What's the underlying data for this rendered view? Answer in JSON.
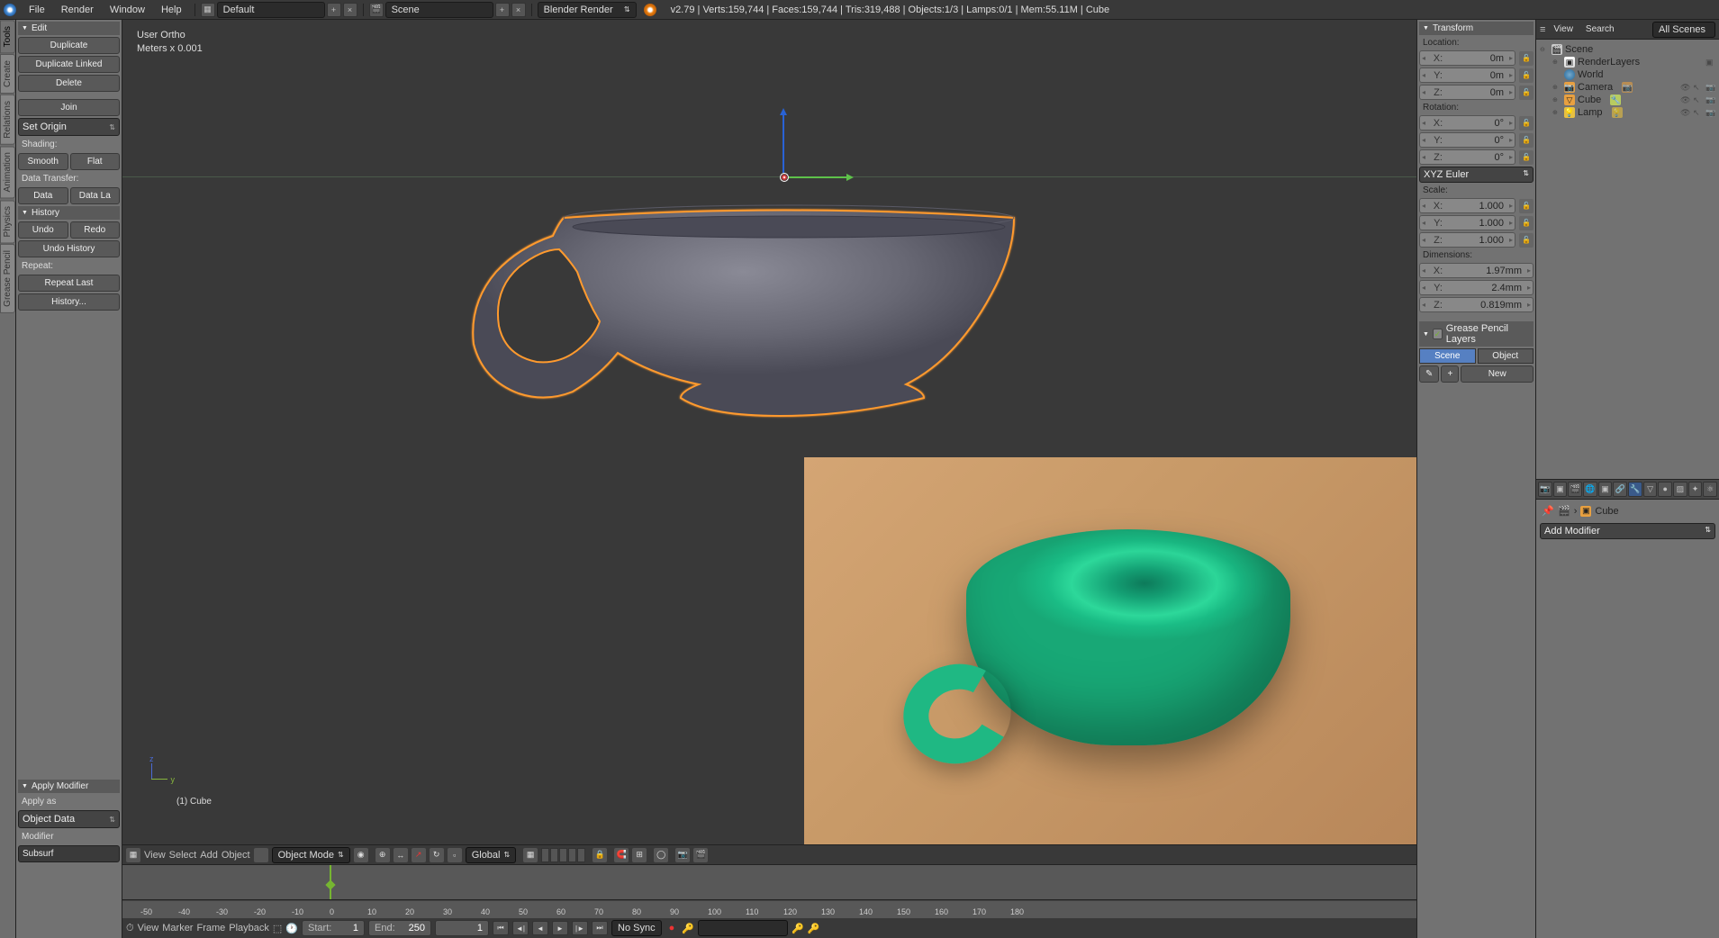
{
  "topbar": {
    "menus": [
      "File",
      "Render",
      "Window",
      "Help"
    ],
    "layout_dd": "Default",
    "scene_dd": "Scene",
    "renderer_dd": "Blender Render",
    "stats": "v2.79 | Verts:159,744 | Faces:159,744 | Tris:319,488 | Objects:1/3 | Lamps:0/1 | Mem:55.11M | Cube"
  },
  "left_tabs": [
    "Tools",
    "Create",
    "Relations",
    "Animation",
    "Physics",
    "Grease Pencil"
  ],
  "tool_panel": {
    "edit_header": "Edit",
    "duplicate": "Duplicate",
    "duplicate_linked": "Duplicate Linked",
    "delete": "Delete",
    "join": "Join",
    "set_origin": "Set Origin",
    "shading_label": "Shading:",
    "smooth": "Smooth",
    "flat": "Flat",
    "data_transfer_label": "Data Transfer:",
    "data": "Data",
    "data_la": "Data La",
    "history_header": "History",
    "undo": "Undo",
    "redo": "Redo",
    "undo_history": "Undo History",
    "repeat_label": "Repeat:",
    "repeat_last": "Repeat Last",
    "history": "History...",
    "apply_modifier_header": "Apply Modifier",
    "apply_as_label": "Apply as",
    "apply_as_value": "Object Data",
    "modifier_label": "Modifier",
    "modifier_value": "Subsurf"
  },
  "viewport": {
    "info_line1": "User Ortho",
    "info_line2": "Meters x 0.001",
    "object_label": "(1) Cube"
  },
  "view_footer": {
    "menus": [
      "View",
      "Select",
      "Add",
      "Object"
    ],
    "mode": "Object Mode",
    "orientation": "Global"
  },
  "timeline": {
    "ticks": [
      "-50",
      "-40",
      "-30",
      "-20",
      "-10",
      "0",
      "10",
      "20",
      "30",
      "40",
      "50",
      "60",
      "70",
      "80",
      "90",
      "100",
      "110",
      "120",
      "130",
      "140",
      "150",
      "160",
      "170",
      "180"
    ],
    "footer_menus": [
      "View",
      "Marker",
      "Frame",
      "Playback"
    ],
    "start_label": "Start:",
    "start_val": "1",
    "end_label": "End:",
    "end_val": "250",
    "current_val": "1",
    "sync": "No Sync"
  },
  "n_panel": {
    "transform_header": "Transform",
    "location_label": "Location:",
    "loc": [
      {
        "a": "X:",
        "v": "0m"
      },
      {
        "a": "Y:",
        "v": "0m"
      },
      {
        "a": "Z:",
        "v": "0m"
      }
    ],
    "rotation_label": "Rotation:",
    "rot": [
      {
        "a": "X:",
        "v": "0°"
      },
      {
        "a": "Y:",
        "v": "0°"
      },
      {
        "a": "Z:",
        "v": "0°"
      }
    ],
    "rot_mode": "XYZ Euler",
    "scale_label": "Scale:",
    "scale": [
      {
        "a": "X:",
        "v": "1.000"
      },
      {
        "a": "Y:",
        "v": "1.000"
      },
      {
        "a": "Z:",
        "v": "1.000"
      }
    ],
    "dimensions_label": "Dimensions:",
    "dim": [
      {
        "a": "X:",
        "v": "1.97mm"
      },
      {
        "a": "Y:",
        "v": "2.4mm"
      },
      {
        "a": "Z:",
        "v": "0.819mm"
      }
    ],
    "gp_header": "Grease Pencil Layers",
    "gp_scene": "Scene",
    "gp_object": "Object",
    "gp_new": "New"
  },
  "outliner": {
    "menus": [
      "View",
      "Search"
    ],
    "filter": "All Scenes",
    "scene": "Scene",
    "render_layers": "RenderLayers",
    "world": "World",
    "camera": "Camera",
    "cube": "Cube",
    "lamp": "Lamp"
  },
  "properties": {
    "breadcrumb_obj": "Cube",
    "add_modifier": "Add Modifier"
  }
}
